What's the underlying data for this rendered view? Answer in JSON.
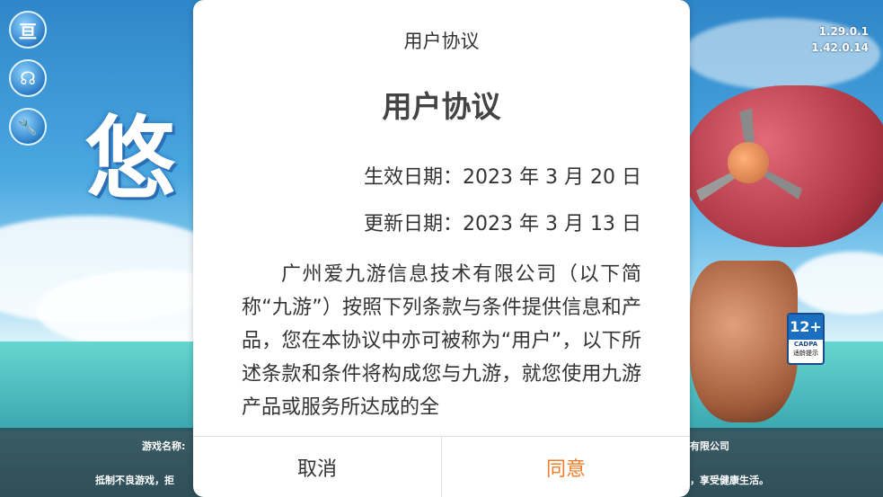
{
  "background": {
    "game_title_art": "悠",
    "versions": [
      "1.29.0.1",
      "1.42.0.14"
    ],
    "side_buttons": [
      {
        "icon": "notice-icon",
        "glyph": "亘"
      },
      {
        "icon": "customer-service-icon",
        "glyph": "☊"
      },
      {
        "icon": "wrench-icon",
        "glyph": "🔧"
      }
    ],
    "footer": {
      "line1_left": "游戏名称:",
      "line1_right": "有限公司",
      "line2_left": "抵制不良游戏，拒",
      "line2_right": "，享受健康生活。"
    },
    "age_rating": {
      "age": "12+",
      "org": "CADPA",
      "label": "适龄提示"
    }
  },
  "dialog": {
    "header": "用户协议",
    "title": "用户协议",
    "effective_date": "生效日期：2023 年 3 月 20 日",
    "updated_date": "更新日期：2023 年 3 月 13 日",
    "body": "广州爱九游信息技术有限公司（以下简称“九游”）按照下列条款与条件提供信息和产品，您在本协议中亦可被称为“用户”，以下所述条款和条件将构成您与九游，就您使用九游产品或服务所达成的全",
    "cancel_label": "取消",
    "agree_label": "同意"
  },
  "colors": {
    "agree": "#f07c2a",
    "footer_bg": "#283c46"
  }
}
